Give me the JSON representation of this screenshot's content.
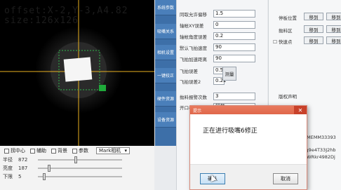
{
  "camera": {
    "overlay_line1": "offset:X-2,Y-3,A4.82",
    "overlay_line2": "size:126x126"
  },
  "camera_options": {
    "items": [
      "拐中心",
      "辅助",
      "背景",
      "参数"
    ],
    "select_value": "Mark相机"
  },
  "sliders": [
    {
      "label": "半径",
      "value": "872",
      "level": 0.45
    },
    {
      "label": "亮度",
      "value": "187",
      "level": 0.12
    },
    {
      "label": "下限",
      "value": "5",
      "level": 0.06
    }
  ],
  "sidenav": [
    "系统参数",
    "吸嘴关系",
    "相机设置",
    "一键校正",
    "硬件资源",
    "设备资源"
  ],
  "fields": [
    {
      "label": "同取允许偏移",
      "value": "1.5"
    },
    {
      "label": "轴帐XY误差",
      "value": "0"
    },
    {
      "label": "轴帐角度误差",
      "value": "0.2"
    },
    {
      "label": "默认飞拍速度",
      "value": "90"
    },
    {
      "label": "飞拍加速距离",
      "value": "90"
    },
    {
      "label": "飞拍误差",
      "value": "0.5"
    },
    {
      "label": "飞拍误差2",
      "value": "0.22"
    },
    {
      "label": "抛料报警次数",
      "value": "3"
    },
    {
      "label": "开口模式",
      "value": "智能"
    }
  ],
  "measure_button": "测量",
  "far_right": {
    "feeder_label": "停板位置",
    "button_label": "移到",
    "throw_label": "抛料区",
    "quick_label": "快速点",
    "copyright_label": "版权声明",
    "serial1": "EMEMM33393",
    "serial2": "rg9e4T33J2hb",
    "serial3": "hWRkr4982Dj"
  },
  "dialog": {
    "title": "提示",
    "message": "正在进行吸嘴6修正",
    "ok": "确认",
    "cancel": "取消"
  }
}
